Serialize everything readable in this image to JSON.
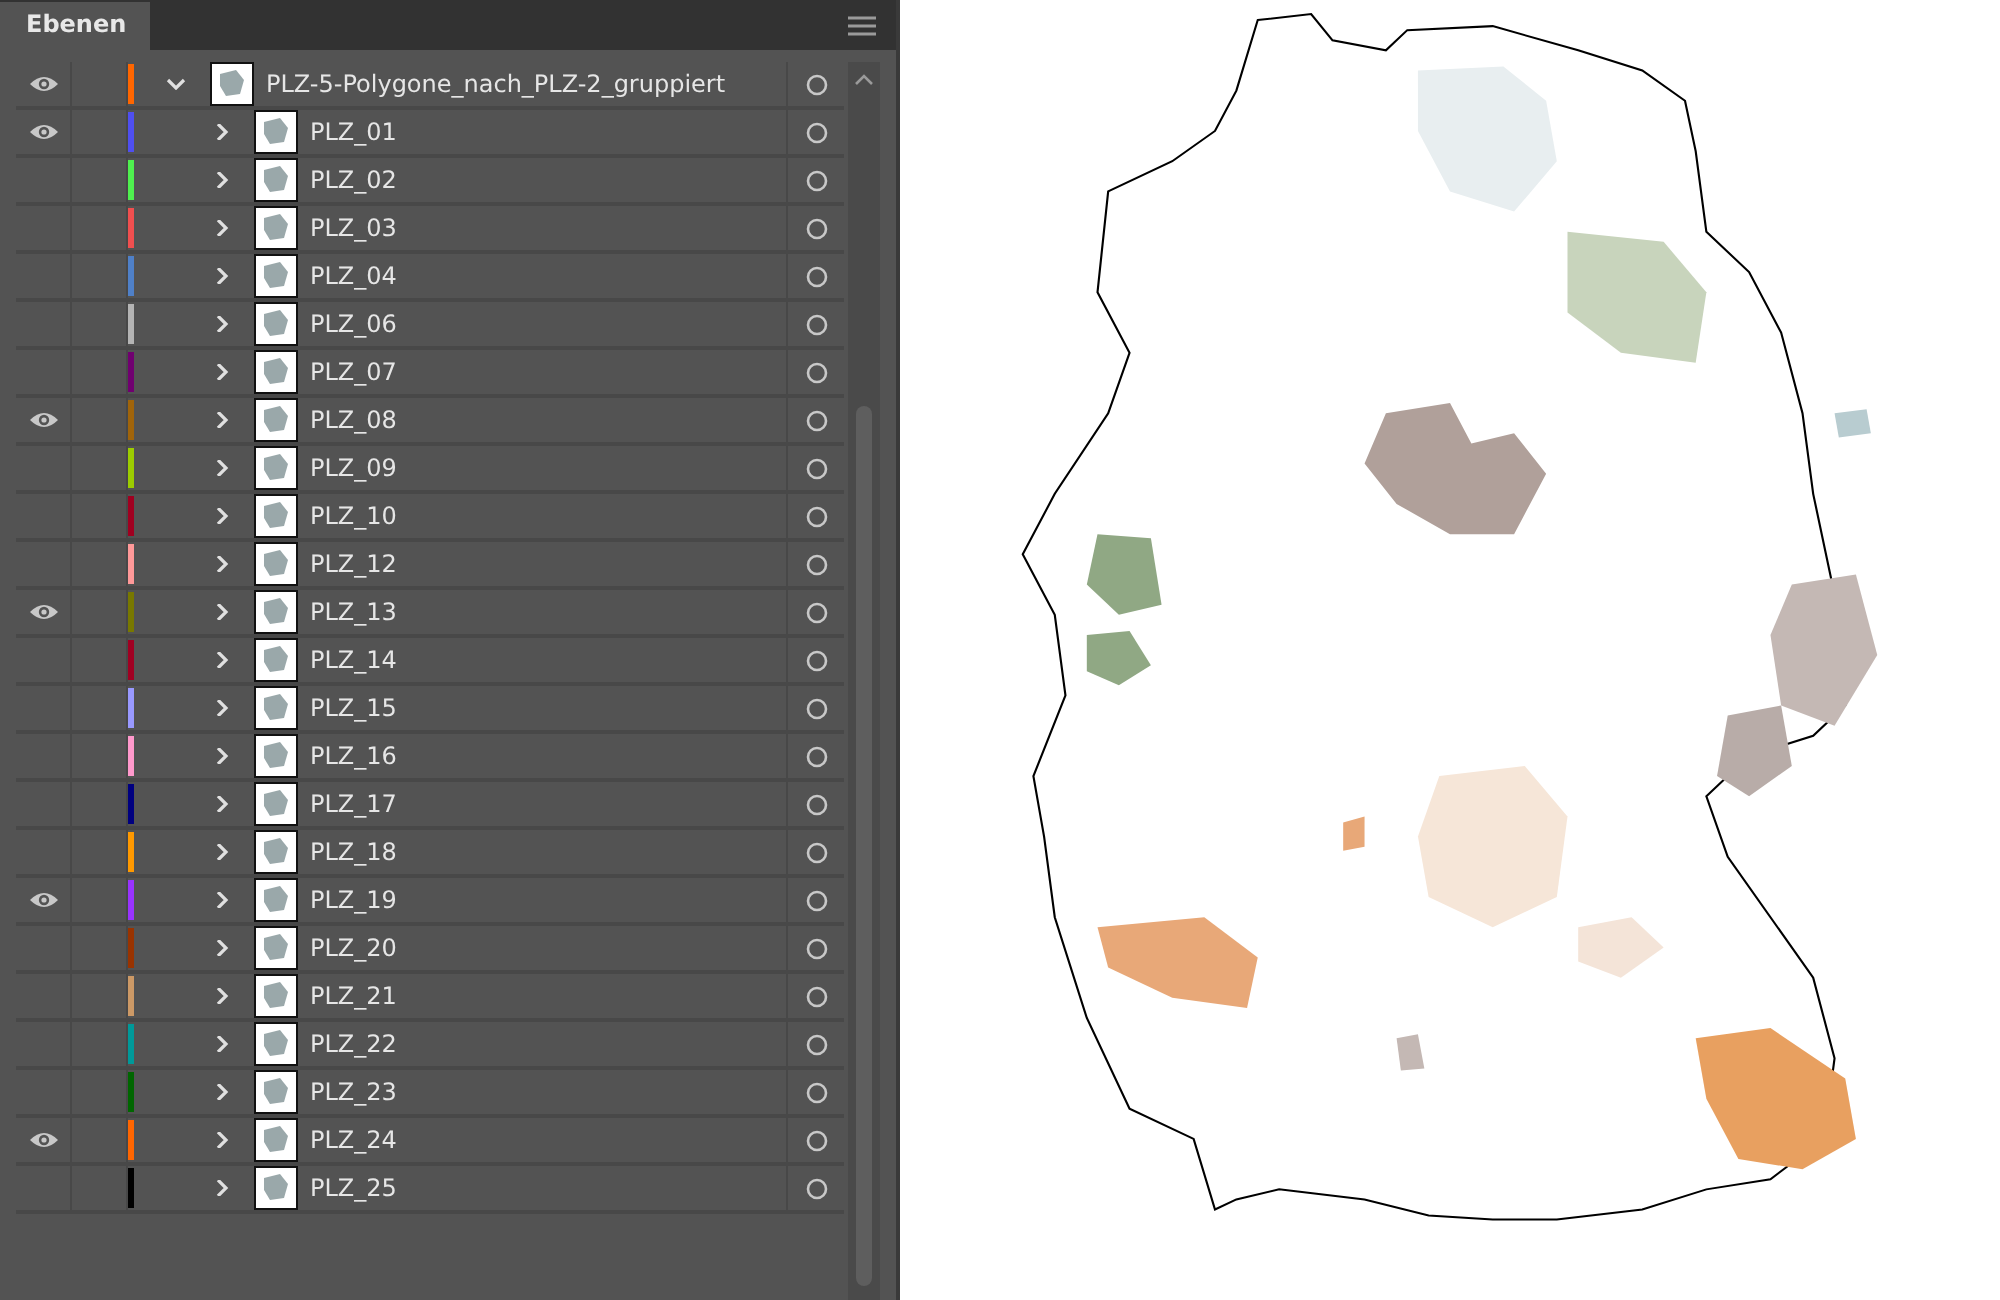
{
  "panel": {
    "tab": "Ebenen"
  },
  "layers": [
    {
      "name": "PLZ-5-Polygone_nach_PLZ-2_gruppiert",
      "visible": true,
      "expanded": true,
      "color": "#ff6600",
      "children": [
        {
          "name": "PLZ_01",
          "visible": true,
          "expanded": false,
          "color": "#4f4ff0"
        },
        {
          "name": "PLZ_02",
          "visible": false,
          "expanded": false,
          "color": "#4ff04f"
        },
        {
          "name": "PLZ_03",
          "visible": false,
          "expanded": false,
          "color": "#f04f4f"
        },
        {
          "name": "PLZ_04",
          "visible": false,
          "expanded": false,
          "color": "#4f80c8"
        },
        {
          "name": "PLZ_06",
          "visible": false,
          "expanded": false,
          "color": "#b4b4b4"
        },
        {
          "name": "PLZ_07",
          "visible": false,
          "expanded": false,
          "color": "#700070"
        },
        {
          "name": "PLZ_08",
          "visible": true,
          "expanded": false,
          "color": "#a0640a"
        },
        {
          "name": "PLZ_09",
          "visible": false,
          "expanded": false,
          "color": "#9ccc00"
        },
        {
          "name": "PLZ_10",
          "visible": false,
          "expanded": false,
          "color": "#a00020"
        },
        {
          "name": "PLZ_12",
          "visible": false,
          "expanded": false,
          "color": "#ff9999"
        },
        {
          "name": "PLZ_13",
          "visible": true,
          "expanded": false,
          "color": "#787800"
        },
        {
          "name": "PLZ_14",
          "visible": false,
          "expanded": false,
          "color": "#a00022"
        },
        {
          "name": "PLZ_15",
          "visible": false,
          "expanded": false,
          "color": "#9999ff"
        },
        {
          "name": "PLZ_16",
          "visible": false,
          "expanded": false,
          "color": "#ff99cc"
        },
        {
          "name": "PLZ_17",
          "visible": false,
          "expanded": false,
          "color": "#000080"
        },
        {
          "name": "PLZ_18",
          "visible": false,
          "expanded": false,
          "color": "#ff9900"
        },
        {
          "name": "PLZ_19",
          "visible": true,
          "expanded": false,
          "color": "#9933ff"
        },
        {
          "name": "PLZ_20",
          "visible": false,
          "expanded": false,
          "color": "#993300"
        },
        {
          "name": "PLZ_21",
          "visible": false,
          "expanded": false,
          "color": "#cc9966"
        },
        {
          "name": "PLZ_22",
          "visible": false,
          "expanded": false,
          "color": "#009999"
        },
        {
          "name": "PLZ_23",
          "visible": false,
          "expanded": false,
          "color": "#006600"
        },
        {
          "name": "PLZ_24",
          "visible": true,
          "expanded": false,
          "color": "#ff6601"
        },
        {
          "name": "PLZ_25",
          "visible": false,
          "expanded": false,
          "color": "#000000"
        }
      ]
    }
  ]
}
